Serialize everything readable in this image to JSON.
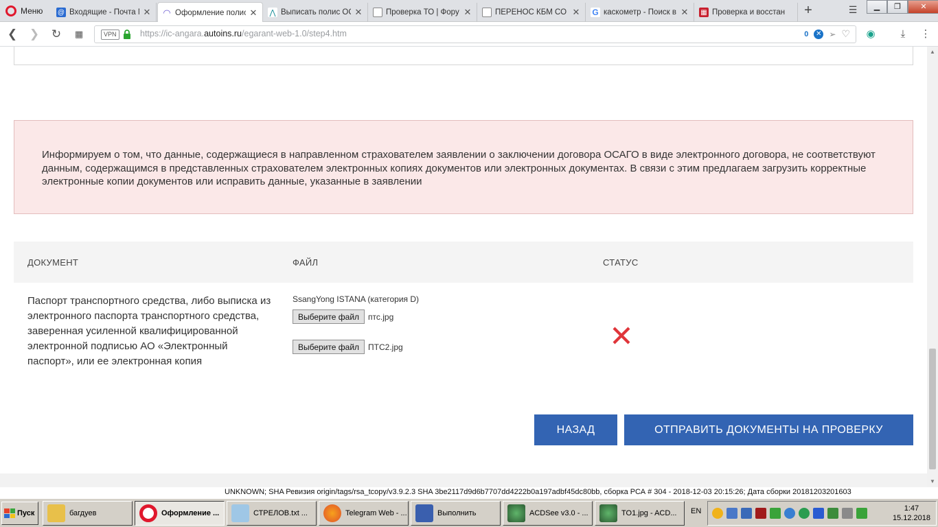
{
  "browser": {
    "menu_label": "Меню",
    "tabs": [
      {
        "title": "Входящие - Почта M",
        "favicon": "mail-icon",
        "color": "#2a6bd1"
      },
      {
        "title": "Оформление полиса",
        "favicon": "site-icon",
        "color": "#6b5ad1",
        "active": true
      },
      {
        "title": "Выписать полис ОСА",
        "favicon": "site-icon",
        "color": "#1b8f9a"
      },
      {
        "title": "Проверка ТО | Фору",
        "favicon": "page-icon",
        "color": "#777777"
      },
      {
        "title": "ПЕРЕНОС КБМ СО СТ",
        "favicon": "page-icon",
        "color": "#777777"
      },
      {
        "title": "каскометр - Поиск в",
        "favicon": "google-icon",
        "color": "#4285f4"
      },
      {
        "title": "Проверка и восстан",
        "favicon": "rsa-icon",
        "color": "#c8202f"
      }
    ],
    "new_tab": "+",
    "url": {
      "scheme": "https://ic-angara.",
      "domain": "autoins.ru",
      "path": "/egarant-web-1.0/step4.htm"
    },
    "vpn_label": "VPN",
    "adblock_count": "0"
  },
  "alert": {
    "text": "Информируем о том, что данные, содержащиеся в направленном страхователем заявлении о заключении договора ОСАГО в виде электронного договора, не соответствуют данным, содержащимся в представленных страхователем электронных копиях документов или электронных документах. В связи с этим предлагаем загрузить корректные электронные копии документов или исправить данные, указанные в заявлении"
  },
  "table": {
    "headers": {
      "document": "ДОКУМЕНТ",
      "file": "ФАЙЛ",
      "status": "СТАТУС"
    },
    "row": {
      "document": "Паспорт транспортного средства, либо выписка из электронного паспорта транспортного средства, заверенная усиленной квалифицированной электронной подписью АО «Электронный паспорт», или ее электронная копия",
      "vehicle": "SsangYong ISTANA (категория D)",
      "files": [
        {
          "button": "Выберите файл",
          "name": "птс.jpg"
        },
        {
          "button": "Выберите файл",
          "name": "ПТС2.jpg"
        }
      ],
      "status": "error"
    }
  },
  "buttons": {
    "back": "НАЗАД",
    "submit": "ОТПРАВИТЬ ДОКУМЕНТЫ НА ПРОВЕРКУ"
  },
  "build_info": "UNKNOWN; SHA Ревизия origin/tags/rsa_tcopy/v3.9.2.3 SHA 3be2117d9d6b7707dd4222b0a197adbf45dc80bb, сборка РСА # 304 - 2018-12-03 20:15:26; Дата сборки 20181203201603",
  "taskbar": {
    "start": "Пуск",
    "tasks": [
      {
        "label": "багдуев"
      },
      {
        "label": "Оформление ..."
      },
      {
        "label": "СТРЕЛОВ.txt ..."
      },
      {
        "label": "Telegram Web - ..."
      },
      {
        "label": "Выполнить"
      },
      {
        "label": "ACDSee v3.0 - ..."
      },
      {
        "label": "TO1.jpg - ACD..."
      }
    ],
    "lang": "EN",
    "time": "1:47",
    "date": "15.12.2018"
  },
  "colors": {
    "accent_blue": "#3364b3",
    "alert_bg": "#fbe8e8",
    "error_red": "#e0353a"
  }
}
